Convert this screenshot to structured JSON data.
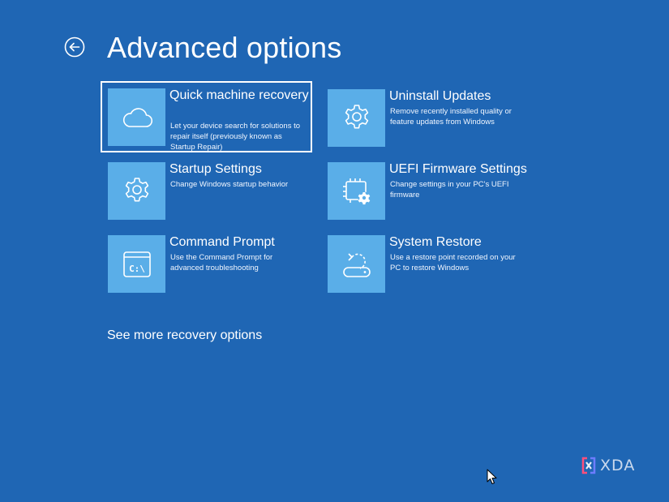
{
  "page": {
    "title": "Advanced options",
    "background_color": "#1f66b4",
    "tile_icon_color": "#5aaee8"
  },
  "back_button": {
    "icon": "back-arrow-icon"
  },
  "tiles": [
    {
      "title": "Quick machine recovery",
      "description": "Let your device search for solutions to repair itself (previously known as Startup Repair)",
      "icon": "cloud-icon",
      "selected": true
    },
    {
      "title": "Uninstall Updates",
      "description": "Remove recently installed quality or feature updates from Windows",
      "icon": "gear-icon",
      "selected": false
    },
    {
      "title": "Startup Settings",
      "description": "Change Windows startup behavior",
      "icon": "gear-icon",
      "selected": false
    },
    {
      "title": "UEFI Firmware Settings",
      "description": "Change settings in your PC's UEFI firmware",
      "icon": "chip-gear-icon",
      "selected": false
    },
    {
      "title": "Command Prompt",
      "description": "Use the Command Prompt for advanced troubleshooting",
      "icon": "command-prompt-icon",
      "icon_text": "C:\\",
      "selected": false
    },
    {
      "title": "System Restore",
      "description": "Use a restore point recorded on your PC to restore Windows",
      "icon": "restore-icon",
      "selected": false
    }
  ],
  "see_more": {
    "label": "See more recovery options"
  },
  "watermark": {
    "text": "XDA",
    "icon": "xda-logo-icon"
  }
}
